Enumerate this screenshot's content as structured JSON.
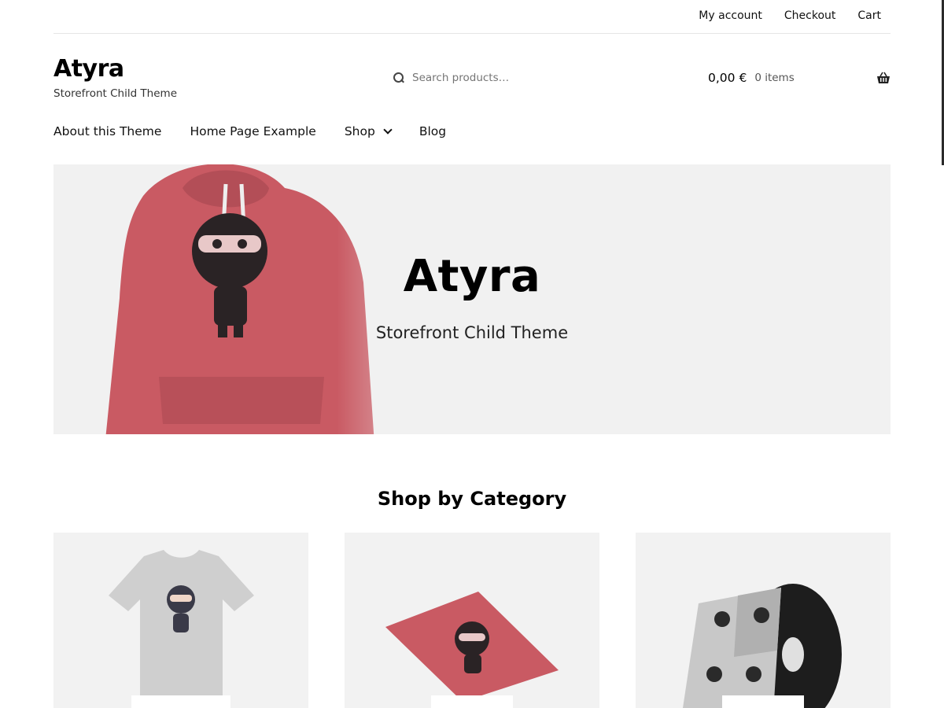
{
  "top_nav": {
    "items": [
      "My account",
      "Checkout",
      "Cart"
    ]
  },
  "header": {
    "site_title": "Atyra",
    "site_description": "Storefront Child Theme",
    "search": {
      "placeholder": "Search products…"
    },
    "cart": {
      "amount": "0,00 €",
      "count": "0 items",
      "icon": "basket-icon"
    }
  },
  "primary_nav": {
    "items": [
      "About this Theme",
      "Home Page Example",
      "Shop",
      "Blog"
    ]
  },
  "hero": {
    "title": "Atyra",
    "subtitle": "Storefront Child Theme",
    "image": "hoodie-ninja-image"
  },
  "categories": {
    "title": "Shop by Category",
    "items": [
      {
        "image": "tshirt-ninja-image"
      },
      {
        "image": "poster-ninja-image"
      },
      {
        "image": "vinyl-album-image"
      }
    ]
  },
  "colors": {
    "hoodie": "#c95a63",
    "hero_bg": "#f1f1f1",
    "text": "#111111"
  }
}
